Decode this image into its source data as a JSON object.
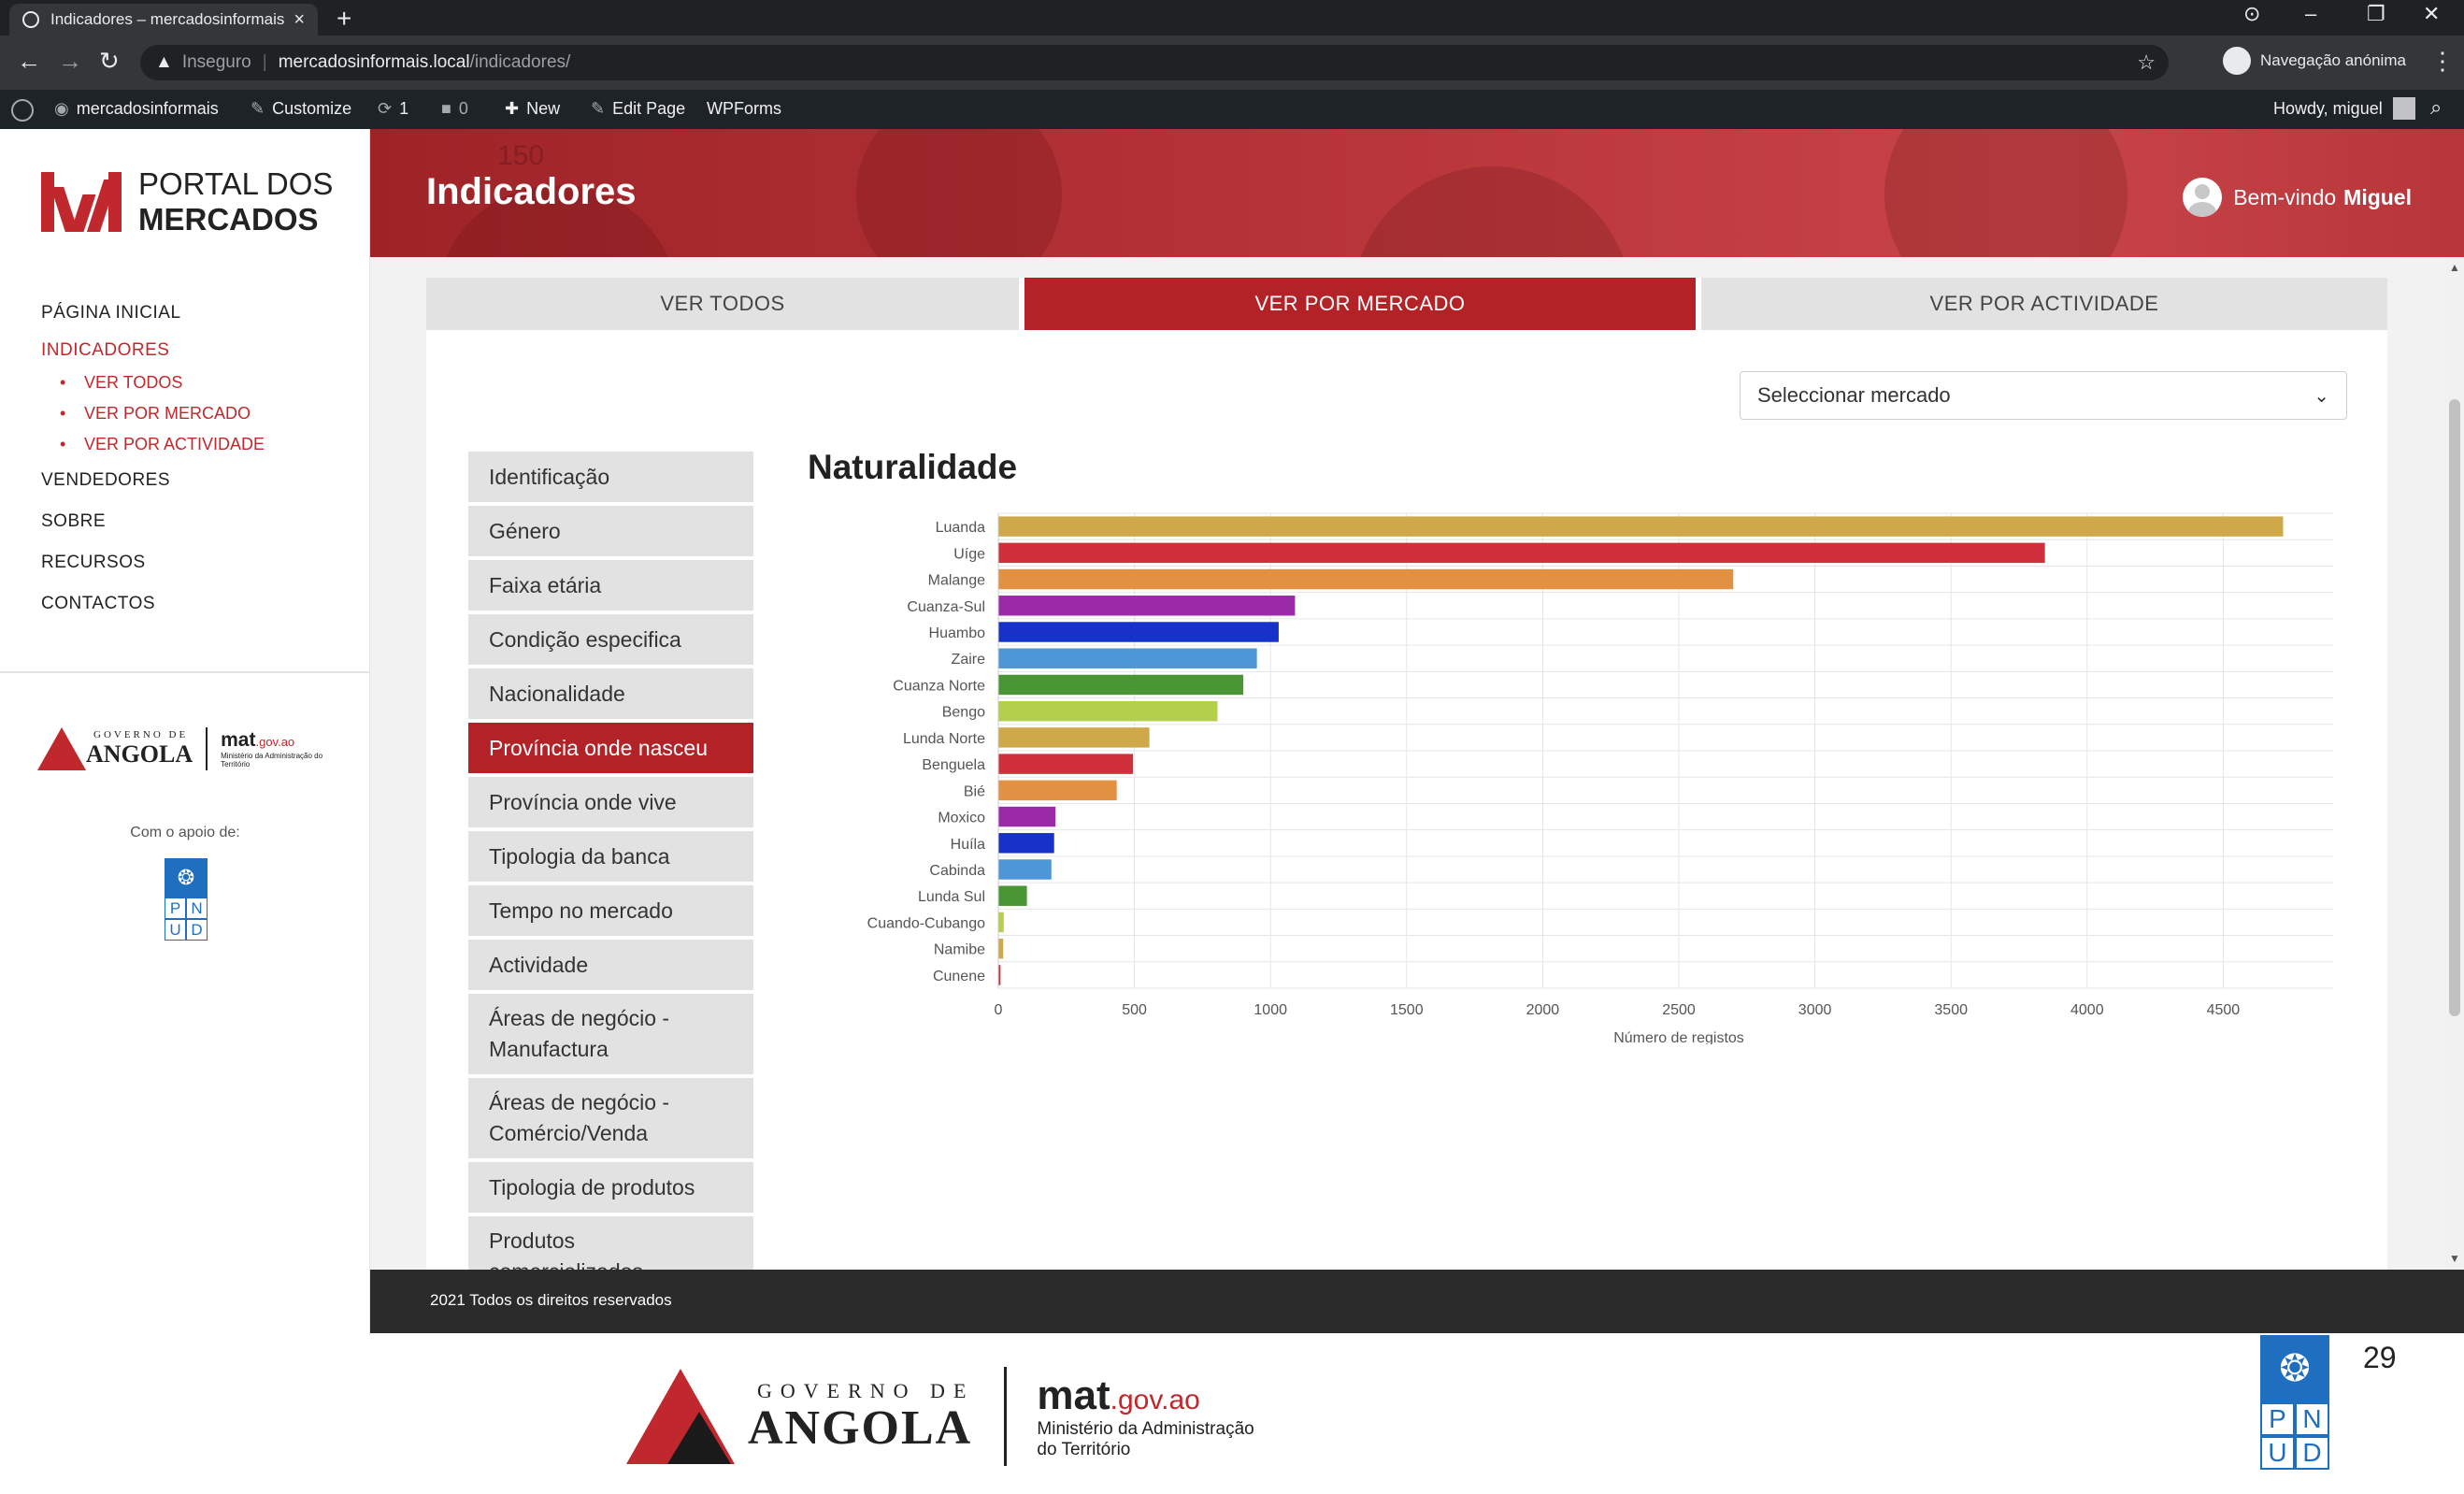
{
  "browser": {
    "tab_title": "Indicadores – mercadosinformais",
    "new_tab_glyph": "+",
    "insecure_label": "Inseguro",
    "url_host": "mercadosinformais.local",
    "url_path": "/indicadores/",
    "incognito_label": "Navegação anónima"
  },
  "wp_admin_bar": {
    "site_name": "mercadosinformais",
    "customize": "Customize",
    "updates_count": "1",
    "comments_count": "0",
    "new_label": "New",
    "edit_page": "Edit Page",
    "wpforms": "WPForms",
    "howdy": "Howdy, miguel"
  },
  "sidebar": {
    "logo_line1": "PORTAL DOS",
    "logo_line2": "MERCADOS",
    "nav": [
      {
        "label": "PÁGINA INICIAL"
      },
      {
        "label": "INDICADORES"
      },
      {
        "label": "VER TODOS"
      },
      {
        "label": "VER POR MERCADO"
      },
      {
        "label": "VER POR ACTIVIDADE"
      },
      {
        "label": "VENDEDORES"
      },
      {
        "label": "SOBRE"
      },
      {
        "label": "RECURSOS"
      },
      {
        "label": "CONTACTOS"
      }
    ],
    "gov_line1": "GOVERNO DE",
    "gov_line2": "ANGOLA",
    "mat_brand": "mat",
    "mat_domain": ".gov.ao",
    "mat_desc": "Ministério da Administração do Território",
    "apoio_label": "Com o apoio de:",
    "pnud_letters": [
      "P",
      "N",
      "U",
      "D"
    ]
  },
  "header": {
    "faint_number": "150",
    "title": "Indicadores",
    "welcome_prefix": "Bem-vindo",
    "user_name": "Miguel"
  },
  "tabs": [
    {
      "label": "VER TODOS"
    },
    {
      "label": "VER POR MERCADO"
    },
    {
      "label": "VER POR ACTIVIDADE"
    }
  ],
  "market_select": {
    "placeholder": "Seleccionar mercado"
  },
  "categories": [
    {
      "label": "Identificação"
    },
    {
      "label": "Género"
    },
    {
      "label": "Faixa etária"
    },
    {
      "label": "Condição especifica"
    },
    {
      "label": "Nacionalidade"
    },
    {
      "label": "Província onde nasceu"
    },
    {
      "label": "Província onde vive"
    },
    {
      "label": "Tipologia da banca"
    },
    {
      "label": "Tempo no mercado"
    },
    {
      "label": "Actividade"
    },
    {
      "label": "Áreas de negócio - Manufactura"
    },
    {
      "label": "Áreas de negócio - Comércio/Venda"
    },
    {
      "label": "Tipologia de produtos"
    },
    {
      "label": "Produtos comercializados"
    }
  ],
  "chart_data": {
    "type": "bar",
    "orientation": "horizontal",
    "title": "Naturalidade",
    "xlabel": "Número de registos",
    "ylabel": "",
    "xlim": [
      0,
      5000
    ],
    "xticks": [
      0,
      500,
      1000,
      1500,
      2000,
      2500,
      3000,
      3500,
      4000,
      4500,
      5000
    ],
    "grid": true,
    "categories": [
      "Luanda",
      "Uíge",
      "Malange",
      "Cuanza-Sul",
      "Huambo",
      "Zaire",
      "Cuanza Norte",
      "Bengo",
      "Lunda Norte",
      "Benguela",
      "Bié",
      "Moxico",
      "Huíla",
      "Cabinda",
      "Lunda Sul",
      "Cuando-Cubango",
      "Namibe",
      "Cunene"
    ],
    "values": [
      4720,
      3845,
      2700,
      1090,
      1030,
      950,
      900,
      805,
      555,
      495,
      435,
      210,
      205,
      195,
      105,
      20,
      18,
      8
    ],
    "colors": [
      "#cfa849",
      "#cf303c",
      "#e29042",
      "#9a2aa8",
      "#1632c9",
      "#4d96d8",
      "#4a9634",
      "#b4d04b",
      "#cfa849",
      "#cf303c",
      "#e29042",
      "#9a2aa8",
      "#1632c9",
      "#4d96d8",
      "#4a9634",
      "#b4d04b",
      "#cfa849",
      "#cf303c"
    ]
  },
  "footer": {
    "text": "2021 Todos os direitos reservados"
  },
  "slide": {
    "gov_line1": "GOVERNO DE",
    "gov_line2": "ANGOLA",
    "mat_brand": "mat",
    "mat_domain": ".gov.ao",
    "mat_desc_line1": "Ministério da Administração",
    "mat_desc_line2": "do Território",
    "pnud_letters": [
      "P",
      "N",
      "U",
      "D"
    ],
    "page_number": "29"
  },
  "colors": {
    "brand_red": "#b22227",
    "header_red": "#b73439",
    "footer_dark": "#2b2b2b",
    "un_blue": "#1f6fc0"
  }
}
